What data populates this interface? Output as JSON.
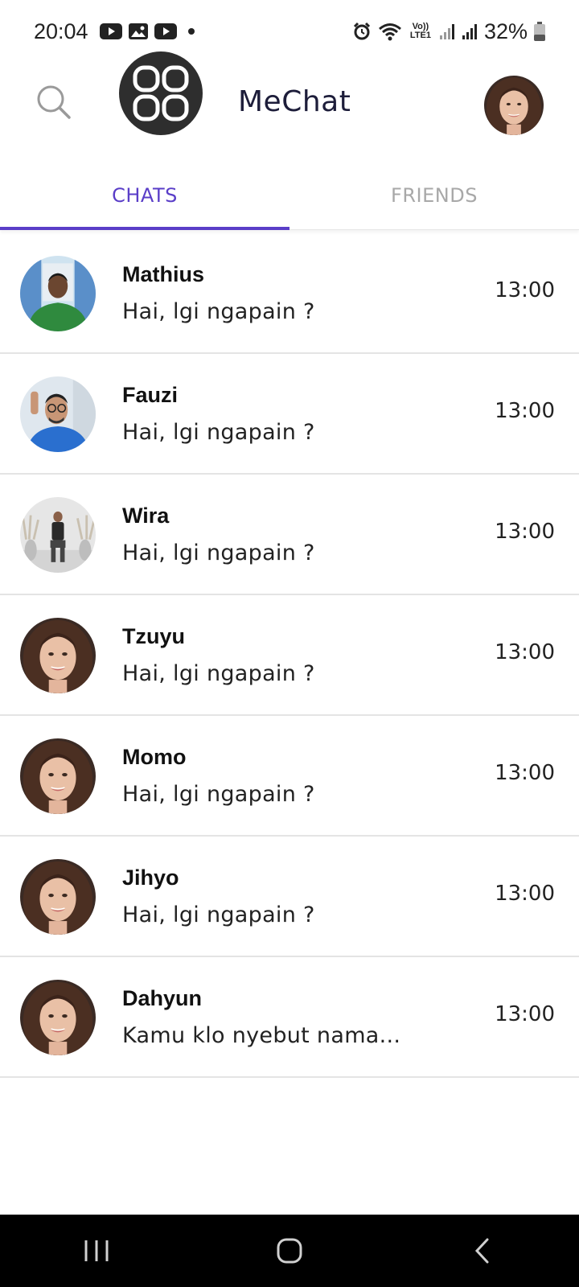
{
  "status_bar": {
    "time": "20:04",
    "battery": "32%",
    "icons_left": [
      "youtube-icon",
      "gallery-icon",
      "youtube-icon"
    ],
    "icons_right": [
      "alarm-icon",
      "wifi-icon",
      "volte-icon",
      "signal-icon",
      "signal-icon",
      "battery-icon"
    ],
    "volte_label": "Vo)) LTE1"
  },
  "header": {
    "title": "MeChat",
    "search_icon": "search-icon",
    "logo_icon": "grid-logo-icon"
  },
  "tabs": [
    {
      "label": "CHATS",
      "active": true
    },
    {
      "label": "FRIENDS",
      "active": false
    }
  ],
  "accent_color": "#5a3ec8",
  "chats": [
    {
      "name": "Mathius",
      "message": "Hai, lgi ngapain ?",
      "time": "13:00"
    },
    {
      "name": "Fauzi",
      "message": "Hai, lgi ngapain ?",
      "time": "13:00"
    },
    {
      "name": "Wira",
      "message": "Hai, lgi ngapain ?",
      "time": "13:00"
    },
    {
      "name": "Tzuyu",
      "message": "Hai, lgi ngapain ?",
      "time": "13:00"
    },
    {
      "name": "Momo",
      "message": "Hai, lgi ngapain ?",
      "time": "13:00"
    },
    {
      "name": "Jihyo",
      "message": "Hai, lgi ngapain ?",
      "time": "13:00"
    },
    {
      "name": "Dahyun",
      "message": "Kamu klo nyebut nama...",
      "time": "13:00"
    }
  ],
  "nav": [
    "recent-apps-icon",
    "home-icon",
    "back-icon"
  ]
}
